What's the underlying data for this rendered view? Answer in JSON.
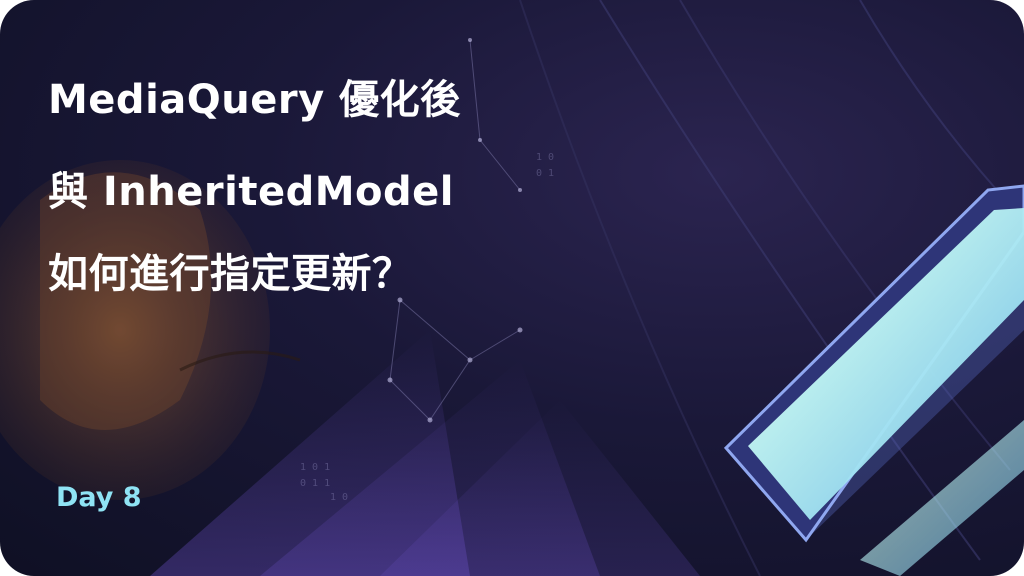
{
  "title_lines": [
    "MediaQuery 優化後",
    "與 InheritedModel",
    "如何進行指定更新？"
  ],
  "day_label": "Day 8",
  "colors": {
    "background": "#15162f",
    "title_text": "#ffffff",
    "day_label": "#8fe3f4",
    "glow": "#bff6f4"
  }
}
